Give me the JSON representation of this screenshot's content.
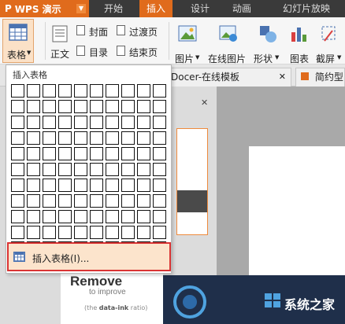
{
  "app": {
    "title": "WPS 演示",
    "logo_letter": "P",
    "dropdown_arrow": "▼"
  },
  "menu": {
    "tabs": [
      {
        "label": "开始"
      },
      {
        "label": "插入"
      },
      {
        "label": "设计"
      },
      {
        "label": "动画"
      },
      {
        "label": "幻灯片放映"
      }
    ],
    "active": "插入"
  },
  "ribbon": {
    "table": "表格",
    "body_text": "正文",
    "cover": "封面",
    "toc": "目录",
    "transition": "过渡页",
    "end_page": "结束页",
    "picture": "图片",
    "online_picture": "在线图片",
    "shape": "形状",
    "chart": "图表",
    "screenshot": "截屏",
    "arrow": "▼"
  },
  "doc_tabs": [
    {
      "label": "Docer-在线模板",
      "close": "✕"
    },
    {
      "label": "简约型"
    }
  ],
  "pane": {
    "close": "✕"
  },
  "table_dropdown": {
    "title": "插入表格",
    "rows": 11,
    "cols": 10,
    "insert_label": "插入表格(I)..."
  },
  "slide": {
    "headline": "Remove",
    "sub": "to improve",
    "footer_pre": "(the ",
    "footer_bold": "data-ink",
    "footer_post": " ratio)"
  },
  "watermark": {
    "site_label": "系统之家"
  },
  "colors": {
    "accent": "#e06b1c",
    "highlight_border": "#d93434",
    "selected_bg": "#fce4cc"
  }
}
